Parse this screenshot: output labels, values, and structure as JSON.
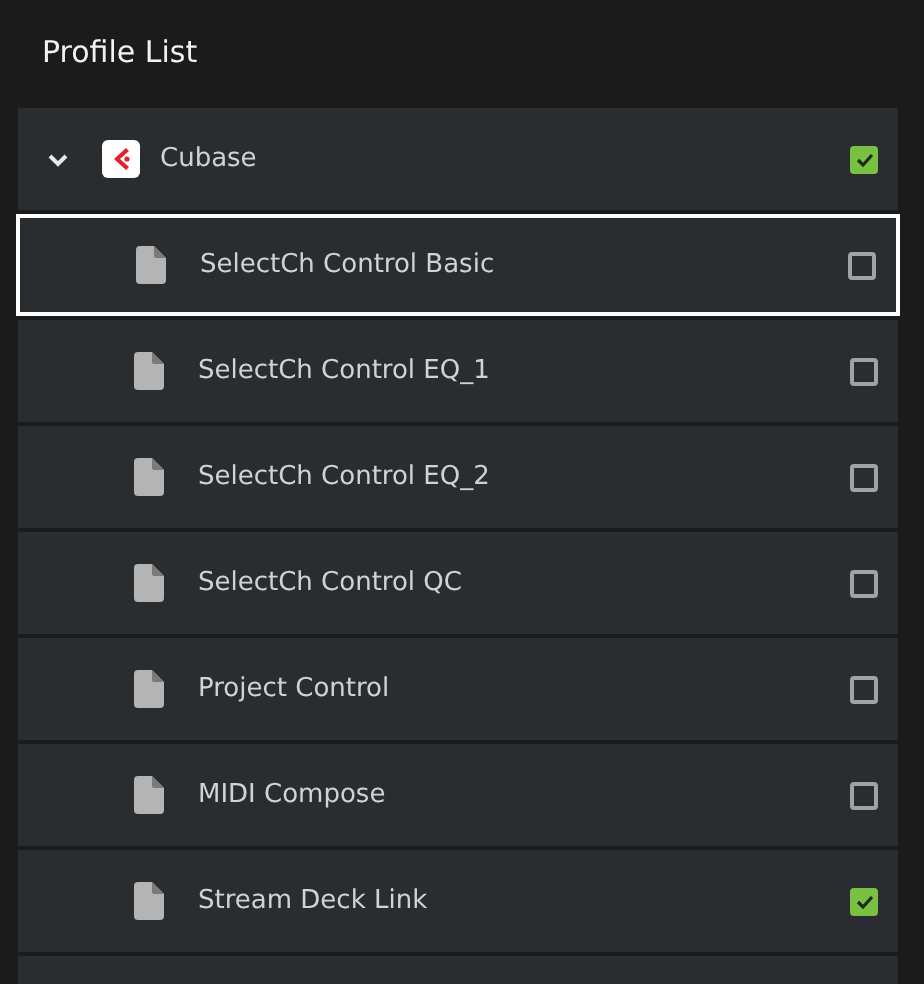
{
  "title": "Profile List",
  "group": {
    "name": "Cubase",
    "expanded": true,
    "checked": true,
    "children": [
      {
        "name": "SelectCh Control Basic",
        "checked": false,
        "selected": true
      },
      {
        "name": "SelectCh Control EQ_1",
        "checked": false,
        "selected": false
      },
      {
        "name": "SelectCh Control EQ_2",
        "checked": false,
        "selected": false
      },
      {
        "name": "SelectCh Control QC",
        "checked": false,
        "selected": false
      },
      {
        "name": "Project Control",
        "checked": false,
        "selected": false
      },
      {
        "name": "MIDI Compose",
        "checked": false,
        "selected": false
      },
      {
        "name": "Stream Deck Link",
        "checked": true,
        "selected": false
      }
    ]
  }
}
